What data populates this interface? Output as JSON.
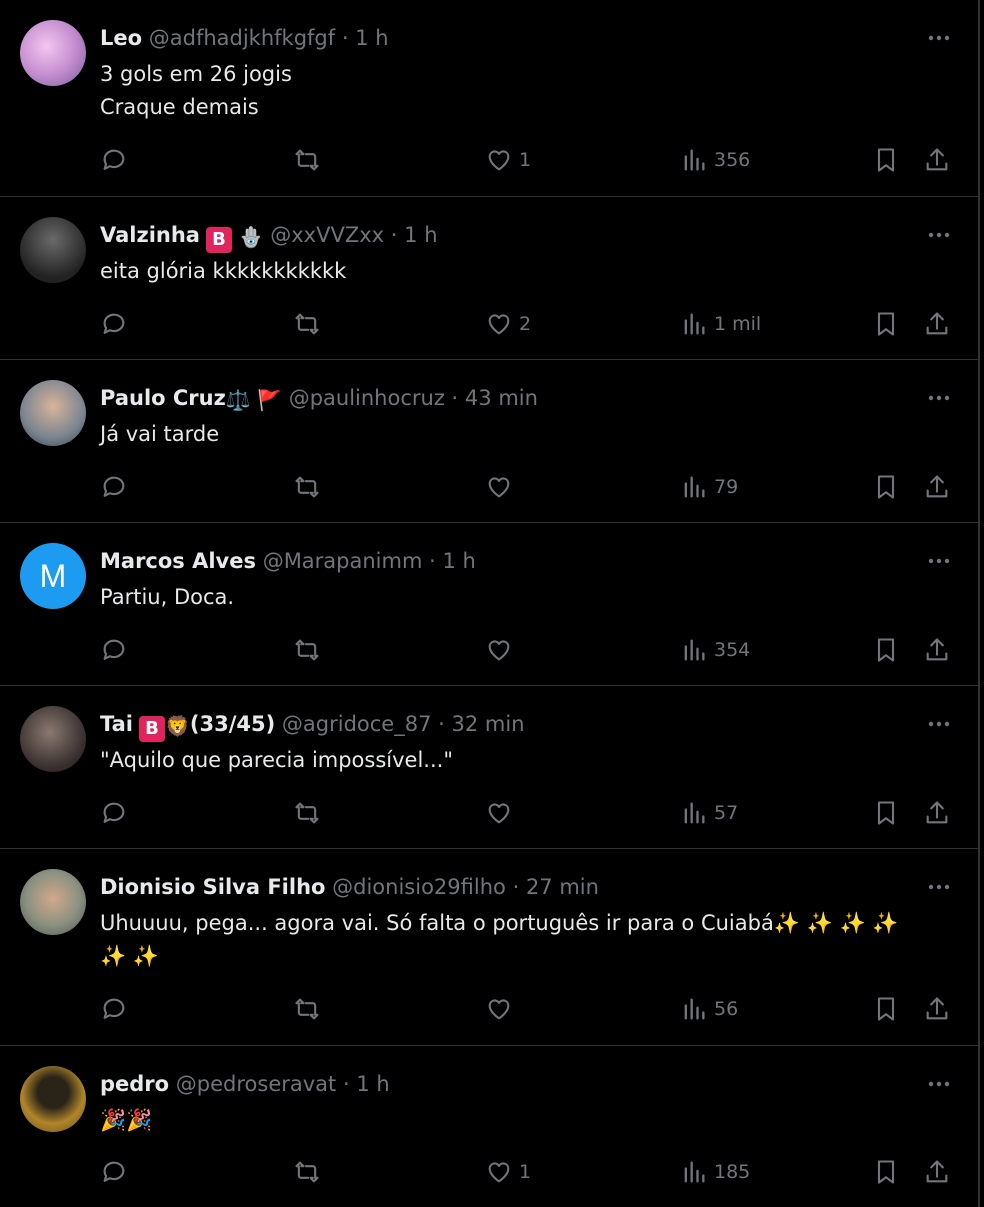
{
  "tweets": [
    {
      "name": "Leo",
      "badges": [],
      "emojis": "",
      "handle": "@adfhadjkhfkgfgf",
      "sep": "·",
      "time": "1 h",
      "text": "3 gols em 26 jogis\nCraque demais",
      "likes": "1",
      "views": "356",
      "avatar_color": "#c68fd0"
    },
    {
      "name": "Valzinha",
      "badges": [
        "B"
      ],
      "emojis": "🪬",
      "handle": "@xxVVZxx",
      "sep": "·",
      "time": "1 h",
      "text": "eita glória kkkkkkkkkkk",
      "likes": "2",
      "views": "1 mil",
      "avatar_color": "#3a3a3a"
    },
    {
      "name": "Paulo Cruz",
      "badges": [],
      "emojis": "⚖️ 🚩",
      "handle": "@paulinhocruz",
      "sep": "·",
      "time": "43 min",
      "text": "Já vai tarde",
      "likes": "",
      "views": "79",
      "avatar_color": "#6b7a86"
    },
    {
      "name": "Marcos Alves",
      "badges": [],
      "emojis": "",
      "handle": "@Marapanimm",
      "sep": "·",
      "time": "1 h",
      "text": "Partiu, Doca.",
      "likes": "",
      "views": "354",
      "avatar_color": "#1d9bf0",
      "avatar_letter": "M"
    },
    {
      "name": "Tai",
      "badges": [
        "B"
      ],
      "emojis": "🦁",
      "name_suffix": "(33/45)",
      "handle": "@agridoce_87",
      "sep": "·",
      "time": "32 min",
      "text": "\"Aquilo que parecia impossível...\"",
      "likes": "",
      "views": "57",
      "avatar_color": "#4a4040"
    },
    {
      "name": "Dionisio Silva Filho",
      "badges": [],
      "emojis": "",
      "handle": "@dionisio29filho",
      "sep": "·",
      "time": "27 min",
      "text": "Uhuuuu, pega... agora vai. Só falta o português ir para o Cuiabá✨ ✨ ✨ ✨\n✨ ✨",
      "likes": "",
      "views": "56",
      "avatar_color": "#8a8a80"
    },
    {
      "name": "pedro",
      "badges": [],
      "emojis": "",
      "handle": "@pedroseravat",
      "sep": "·",
      "time": "1 h",
      "text": "🎉🎉",
      "likes": "1",
      "views": "185",
      "avatar_color": "#b0852a"
    }
  ]
}
